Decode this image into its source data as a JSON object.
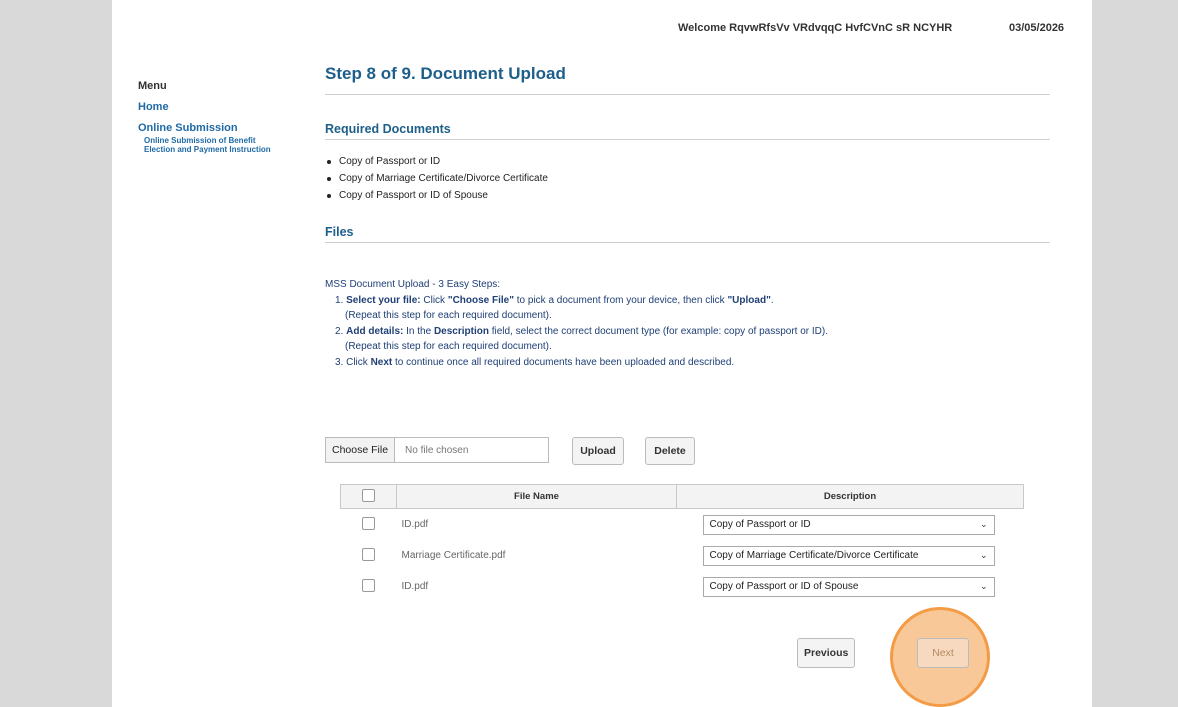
{
  "header": {
    "welcome": "Welcome RqvwRfsVv VRdvqqC HvfCVnC sR NCYHR",
    "date": "03/05/2026"
  },
  "sidebar": {
    "title": "Menu",
    "home": "Home",
    "online_submission": "Online Submission",
    "sub_line1": "Online Submission of Benefit",
    "sub_line2": "Election and Payment Instruction"
  },
  "main": {
    "title": "Step 8 of 9. Document Upload",
    "required_heading": "Required Documents",
    "required_docs": [
      "Copy of Passport or ID",
      "Copy of Marriage Certificate/Divorce Certificate",
      "Copy of Passport or ID of Spouse"
    ],
    "files_heading": "Files",
    "instructions": {
      "intro": "MSS Document Upload - 3 Easy Steps:",
      "s1_num": "1. ",
      "s1_bold": "Select your file:",
      "s1_a": " Click ",
      "s1_b": "\"Choose File\"",
      "s1_c": " to pick a document from your device, then click ",
      "s1_d": "\"Upload\"",
      "s1_e": ".",
      "s1_repeat": "(Repeat this step for each required document).",
      "s2_num": "2. ",
      "s2_bold": "Add details:",
      "s2_a": " In the ",
      "s2_b": "Description",
      "s2_c": " field, select the correct document type (for example: copy of passport or ID).",
      "s2_repeat": "(Repeat this step for each required document).",
      "s3_a": "3. Click ",
      "s3_b": "Next",
      "s3_c": " to continue once all required documents have been uploaded and described."
    },
    "choose_file": "Choose File",
    "no_file": "No file chosen",
    "upload": "Upload",
    "delete": "Delete",
    "table": {
      "headers": [
        "",
        "File Name",
        "Description"
      ],
      "rows": [
        {
          "file": "ID.pdf",
          "desc": "Copy of Passport or ID"
        },
        {
          "file": "Marriage Certificate.pdf",
          "desc": "Copy of Marriage Certificate/Divorce Certificate"
        },
        {
          "file": "ID.pdf",
          "desc": "Copy of Passport or ID of Spouse"
        }
      ]
    },
    "previous": "Previous",
    "next": "Next"
  },
  "colors": {
    "heading": "#1d5f8a",
    "link": "#1f6aa6",
    "highlight": "#f39b45"
  }
}
